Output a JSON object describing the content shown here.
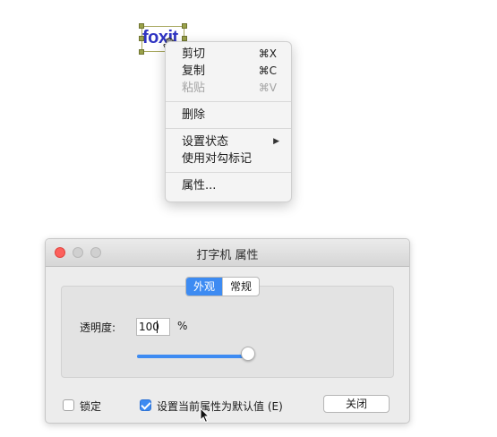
{
  "selection": {
    "text": "foxit"
  },
  "context_menu": {
    "items": [
      {
        "label": "剪切",
        "shortcut": "⌘X",
        "enabled": true
      },
      {
        "label": "复制",
        "shortcut": "⌘C",
        "enabled": true
      },
      {
        "label": "粘贴",
        "shortcut": "⌘V",
        "enabled": false
      },
      {
        "label": "删除"
      },
      {
        "label": "设置状态",
        "submenu": true
      },
      {
        "label": "使用对勾标记"
      },
      {
        "label": "属性..."
      }
    ]
  },
  "window": {
    "title": "打字机 属性",
    "tabs": [
      {
        "label": "外观",
        "active": true
      },
      {
        "label": "常规",
        "active": false
      }
    ],
    "opacity": {
      "label": "透明度:",
      "value": "100",
      "unit": "%",
      "slider_fraction": 1.0
    },
    "lock": {
      "label": "锁定",
      "checked": false
    },
    "default": {
      "label": "设置当前属性为默认值 (E)",
      "checked": true
    },
    "close_label": "关闭"
  },
  "colors": {
    "accent": "#3d8bf2",
    "close_light": "#fc605c",
    "annotation_text": "#2f34c2"
  }
}
